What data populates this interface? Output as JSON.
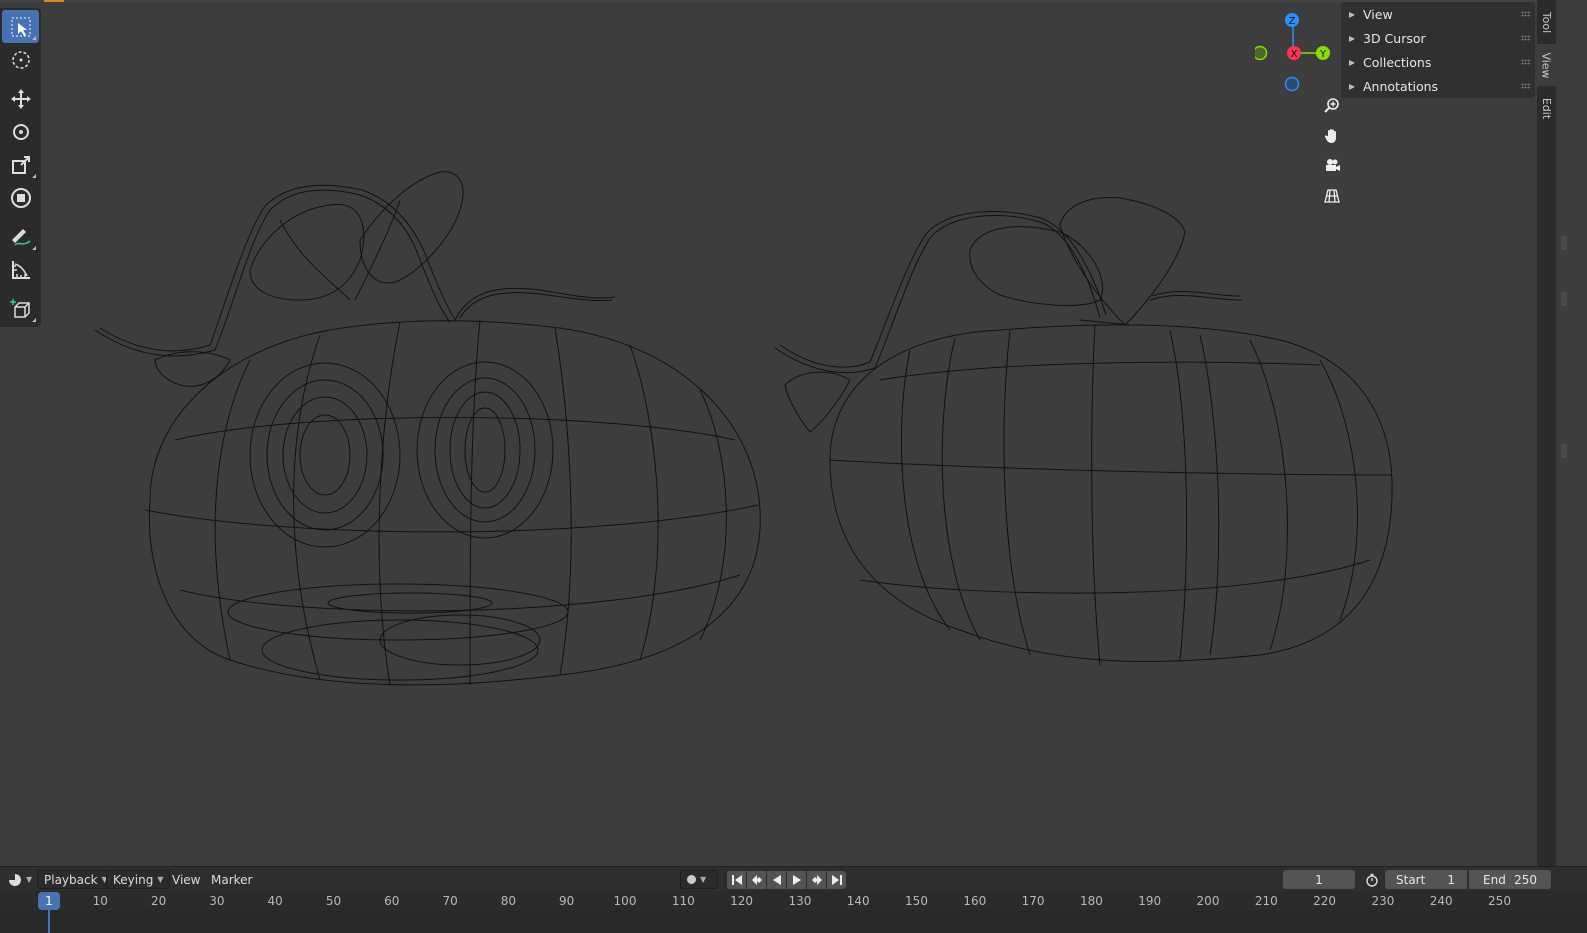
{
  "viewport": {
    "toolbar_tools": [
      "select-box",
      "cursor",
      "move",
      "rotate",
      "scale",
      "transform",
      "annotate",
      "measure",
      "add-cube"
    ],
    "active_tool": "select-box",
    "gizmo": {
      "z_label": "Z",
      "y_label": "Y",
      "x_label": "X",
      "x_color": "#ff3352",
      "y_color": "#8bdc00",
      "z_color": "#2890ff"
    },
    "nav_buttons": [
      "zoom-icon",
      "pan-hand-icon",
      "camera-icon",
      "perspective-grid-icon"
    ]
  },
  "sidebar": {
    "panels": [
      {
        "label": "View"
      },
      {
        "label": "3D Cursor"
      },
      {
        "label": "Collections"
      },
      {
        "label": "Annotations"
      }
    ],
    "tabs": [
      "Tool",
      "View",
      "Edit"
    ],
    "active_tab": "View"
  },
  "timeline": {
    "menu": {
      "playback": "Playback",
      "keying": "Keying",
      "view": "View",
      "marker": "Marker"
    },
    "current_frame": "1",
    "start_label": "Start",
    "start_value": "1",
    "end_label": "End",
    "end_value": "250",
    "ruler_ticks": [
      "1",
      "10",
      "20",
      "30",
      "40",
      "50",
      "60",
      "70",
      "80",
      "90",
      "100",
      "110",
      "120",
      "130",
      "140",
      "150",
      "160",
      "170",
      "180",
      "190",
      "200",
      "210",
      "220",
      "230",
      "240",
      "250"
    ]
  },
  "colors": {
    "accent": "#4772b3",
    "background": "#3d3d3d",
    "panel": "#303030"
  }
}
